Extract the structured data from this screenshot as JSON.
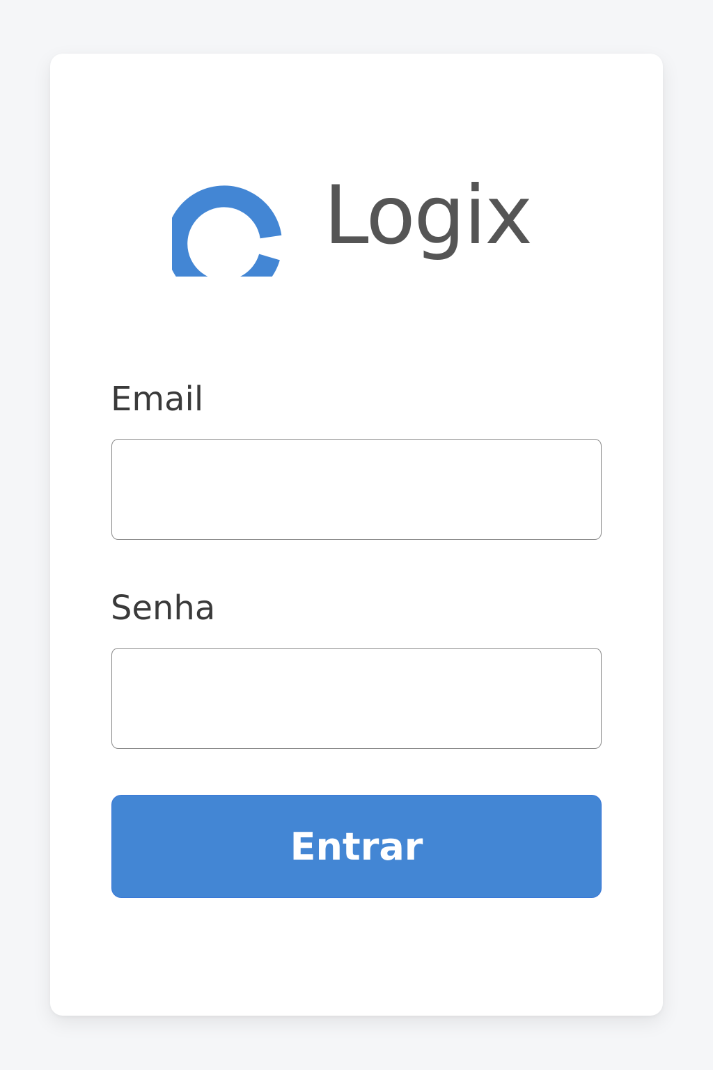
{
  "brand": {
    "name": "Logix",
    "logo_icon": "ring-logo-icon",
    "logo_color": "#4386d4",
    "text_color": "#555555"
  },
  "form": {
    "email_label": "Email",
    "email_value": "",
    "email_placeholder": "",
    "password_label": "Senha",
    "password_value": "",
    "password_placeholder": "",
    "submit_label": "Entrar"
  },
  "colors": {
    "background": "#f5f6f8",
    "card": "#ffffff",
    "accent": "#4386d4",
    "label": "#3a3a3a"
  }
}
